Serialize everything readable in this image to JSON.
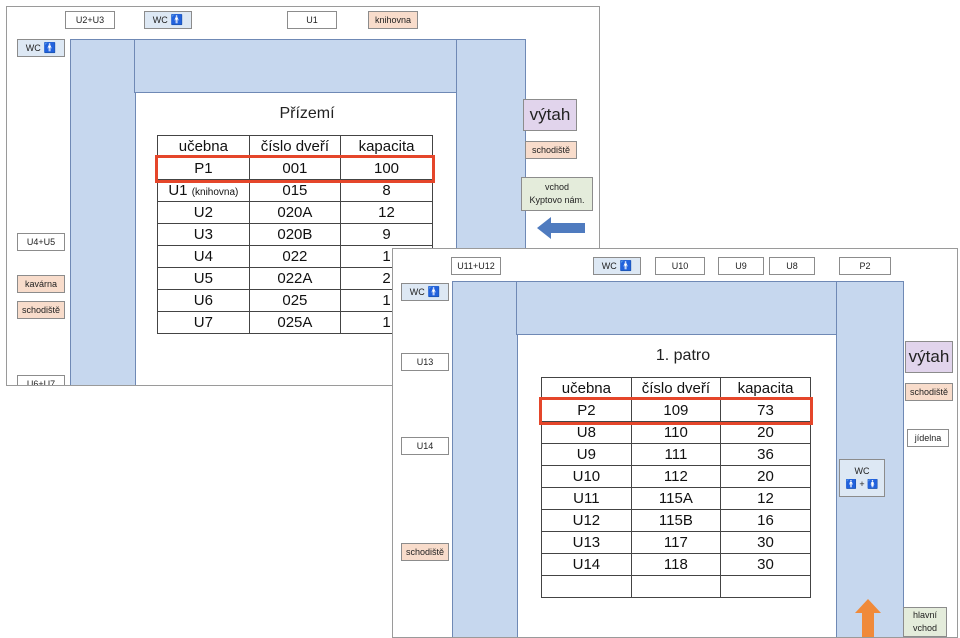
{
  "ground": {
    "title": "Přízemí",
    "headers": [
      "učebna",
      "číslo dveří",
      "kapacita"
    ],
    "rows": [
      [
        "P1",
        "001",
        "100"
      ],
      [
        "U1",
        "015",
        "8"
      ],
      [
        "U2",
        "020A",
        "12"
      ],
      [
        "U3",
        "020B",
        "9"
      ],
      [
        "U4",
        "022",
        "1"
      ],
      [
        "U5",
        "022A",
        "2"
      ],
      [
        "U6",
        "025",
        "1"
      ],
      [
        "U7",
        "025A",
        "1"
      ]
    ],
    "row1_suffix": "(knihovna)",
    "labels": {
      "u2u3": "U2+U3",
      "wc_top": "WC",
      "u1": "U1",
      "knihovna": "knihovna",
      "wc_left": "WC",
      "u4u5": "U4+U5",
      "kavarna": "kavárna",
      "schodiste_left": "schodiště",
      "u6u7": "U6+U7",
      "vytah": "výtah",
      "schodiste_right": "schodiště",
      "vchod_1": "vchod",
      "vchod_2": "Kyptovo nám."
    },
    "highlighted_row": "P1"
  },
  "first": {
    "title": "1. patro",
    "headers": [
      "učebna",
      "číslo dveří",
      "kapacita"
    ],
    "rows": [
      [
        "P2",
        "109",
        "73"
      ],
      [
        "U8",
        "110",
        "20"
      ],
      [
        "U9",
        "111",
        "36"
      ],
      [
        "U10",
        "112",
        "20"
      ],
      [
        "U11",
        "115A",
        "12"
      ],
      [
        "U12",
        "115B",
        "16"
      ],
      [
        "U13",
        "117",
        "30"
      ],
      [
        "U14",
        "118",
        "30"
      ]
    ],
    "labels": {
      "u11u12": "U11+U12",
      "wc_top": "WC",
      "u10": "U10",
      "u9": "U9",
      "u8": "U8",
      "p2": "P2",
      "wc_left": "WC",
      "u13": "U13",
      "u14": "U14",
      "schodiste_left": "schodiště",
      "vytah": "výtah",
      "schodiste_right": "schodiště",
      "jidelna": "jídelna",
      "wc_mid": "WC",
      "wc_mid_figures": "🚹 + 🚺",
      "hlavni_1": "hlavní",
      "hlavni_2": "vchod"
    },
    "highlighted_row": "P2"
  },
  "colors": {
    "corridor": "#c6d7ee",
    "highlight": "#e5462a",
    "arrow_blue": "#4f7bbf",
    "arrow_orange": "#f08a3a"
  },
  "icons": [
    "person-icon",
    "left-arrow-icon",
    "up-arrow-icon"
  ]
}
